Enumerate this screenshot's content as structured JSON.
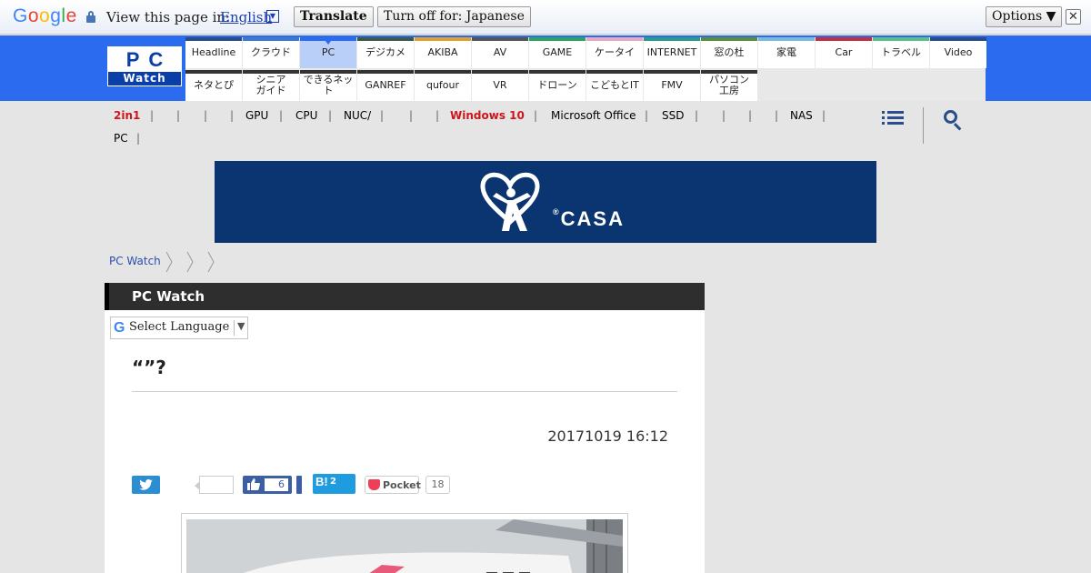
{
  "translate_bar": {
    "logo": "Google",
    "prompt": "View this page in:",
    "language": "English",
    "translate_label": "Translate",
    "turn_off_label": "Turn off for: Japanese",
    "options_label": "Options ▼",
    "close_label": "✕"
  },
  "site": {
    "logo_top": "PC",
    "logo_bottom": "Watch"
  },
  "nav": {
    "row1": [
      {
        "label": "Headline",
        "color": "#2b4c8c"
      },
      {
        "label": "クラウド",
        "color": "#3a7ad0"
      },
      {
        "label": "PC",
        "color": "#2b6bf0",
        "active": true
      },
      {
        "label": "デジカメ",
        "color": "#3c5a4c"
      },
      {
        "label": "AKIBA",
        "color": "#e0a030"
      },
      {
        "label": "AV",
        "color": "#555555"
      },
      {
        "label": "GAME",
        "color": "#2aa460"
      },
      {
        "label": "ケータイ",
        "color": "#e7a8c0"
      },
      {
        "label": "INTERNET",
        "color": "#2a9a8a"
      },
      {
        "label": "窓の杜",
        "color": "#5b8d3a"
      },
      {
        "label": "家電",
        "color": "#7ab8e0"
      },
      {
        "label": "Car",
        "color": "#c03040"
      },
      {
        "label": "トラベル",
        "color": "#5ac08a"
      },
      {
        "label": "Video",
        "color": "#2b4c8c"
      }
    ],
    "row2": [
      {
        "label": "ネタとぴ"
      },
      {
        "label": "シニア\nガイド"
      },
      {
        "label": "できるネット"
      },
      {
        "label": "GANREF"
      },
      {
        "label": "qufour"
      },
      {
        "label": "VR"
      },
      {
        "label": "ドローン"
      },
      {
        "label": "こどもとIT"
      },
      {
        "label": "FMV"
      },
      {
        "label": "パソコン\n工房"
      }
    ]
  },
  "topics": {
    "items": [
      "2in1",
      "",
      "",
      "",
      "GPU",
      "CPU",
      "NUC/",
      "",
      "",
      "Windows 10",
      "Microsoft Office",
      "SSD",
      "",
      "",
      "",
      "NAS"
    ],
    "second_row": [
      "PC"
    ],
    "red": [
      "2in1",
      "Windows 10"
    ]
  },
  "banner": {
    "text": "CASA",
    "mark": "®"
  },
  "breadcrumb": {
    "home": "PC Watch"
  },
  "panel": {
    "header_title": "PC Watch",
    "lang_g": "G",
    "lang_select": "Select Language",
    "lang_arrow": "▼",
    "article_title": "“”?",
    "date": "20171019 16:12"
  },
  "share": {
    "facebook_count": "6",
    "hatena_label": "B!",
    "hatena_count": "2",
    "pocket_label": "Pocket",
    "pocket_count": "18"
  }
}
